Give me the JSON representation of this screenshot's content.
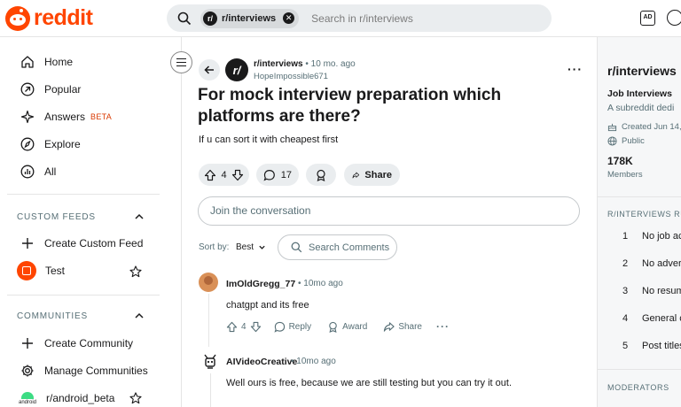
{
  "header": {
    "logo_text": "reddit",
    "search_chip": "r/interviews",
    "search_placeholder": "Search in r/interviews"
  },
  "sidebar": {
    "nav": [
      {
        "label": "Home",
        "icon": "home-icon"
      },
      {
        "label": "Popular",
        "icon": "popular-arrow-icon"
      },
      {
        "label": "Answers",
        "icon": "answers-icon",
        "badge": "BETA"
      },
      {
        "label": "Explore",
        "icon": "explore-icon"
      },
      {
        "label": "All",
        "icon": "all-bar-chart-icon"
      }
    ],
    "custom_feeds_heading": "CUSTOM FEEDS",
    "create_custom_feed": "Create Custom Feed",
    "feed_test": "Test",
    "communities_heading": "COMMUNITIES",
    "create_community": "Create Community",
    "manage_communities": "Manage Communities",
    "android_beta": "r/android_beta",
    "android_icon_word": "android"
  },
  "post": {
    "subreddit": "r/interviews",
    "dot": "•",
    "time": "10 mo. ago",
    "author": "HopeImpossible671",
    "title": "For mock interview preparation which platforms are there?",
    "body": "If u can sort it with cheapest first",
    "votes": "4",
    "comments": "17",
    "share": "Share"
  },
  "join_placeholder": "Join the conversation",
  "sort": {
    "label": "Sort by:",
    "value": "Best",
    "search_comments": "Search Comments"
  },
  "comments": [
    {
      "author": "ImOldGregg_77",
      "time": "10mo ago",
      "text": "chatgpt and its free",
      "votes": "4",
      "reply": "Reply",
      "award": "Award",
      "share": "Share"
    },
    {
      "author": "AIVideoCreative",
      "time": "10mo ago",
      "text": "Well ours is free, because we are still testing but you can try it out."
    }
  ],
  "right_panel": {
    "title": "r/interviews",
    "subtitle": "Job Interviews",
    "desc": "A subreddit dedi",
    "created": "Created Jun 14,",
    "visibility": "Public",
    "members_count": "178K",
    "members_label": "Members",
    "rules_heading": "R/INTERVIEWS RUL",
    "rules": [
      {
        "n": "1",
        "text": "No job ac"
      },
      {
        "n": "2",
        "text": "No advert"
      },
      {
        "n": "3",
        "text": "No resum"
      },
      {
        "n": "4",
        "text": "General c"
      },
      {
        "n": "5",
        "text": "Post titles"
      }
    ],
    "moderators_heading": "MODERATORS"
  },
  "colors": {
    "brand": "#ff4500",
    "beta": "#d93900",
    "android": "#3ddc84"
  }
}
